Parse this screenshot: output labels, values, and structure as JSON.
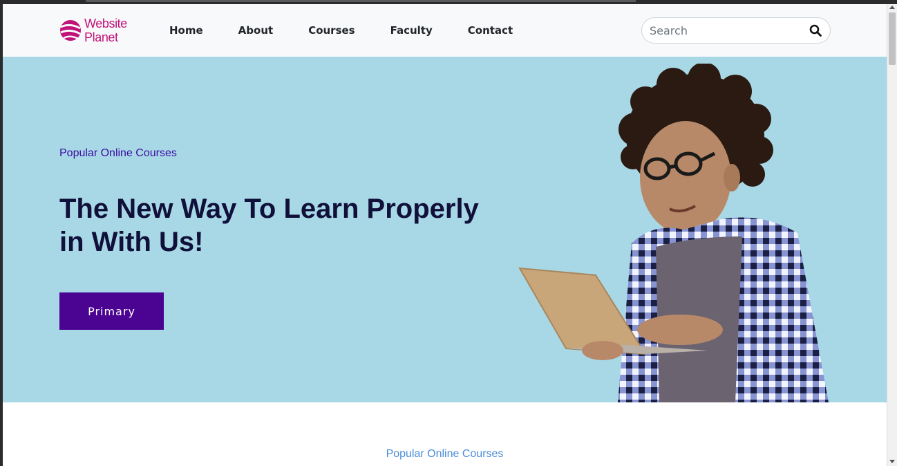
{
  "brand": {
    "line1": "Website",
    "line2": "Planet",
    "logo_icon": "website-planet-logo",
    "color": "#c0137a"
  },
  "nav": {
    "items": [
      "Home",
      "About",
      "Courses",
      "Faculty",
      "Contact"
    ]
  },
  "search": {
    "placeholder": "Search",
    "value": "",
    "icon": "search-icon"
  },
  "hero": {
    "eyebrow": "Popular Online Courses",
    "headline_line1": "The New Way To Learn Properly",
    "headline_line2": "in With Us!",
    "button_label": "Primary",
    "background": "#a8d8e6",
    "button_color": "#4b0392",
    "image": "student-with-laptop"
  },
  "section": {
    "eyebrow": "Popular Online Courses"
  }
}
